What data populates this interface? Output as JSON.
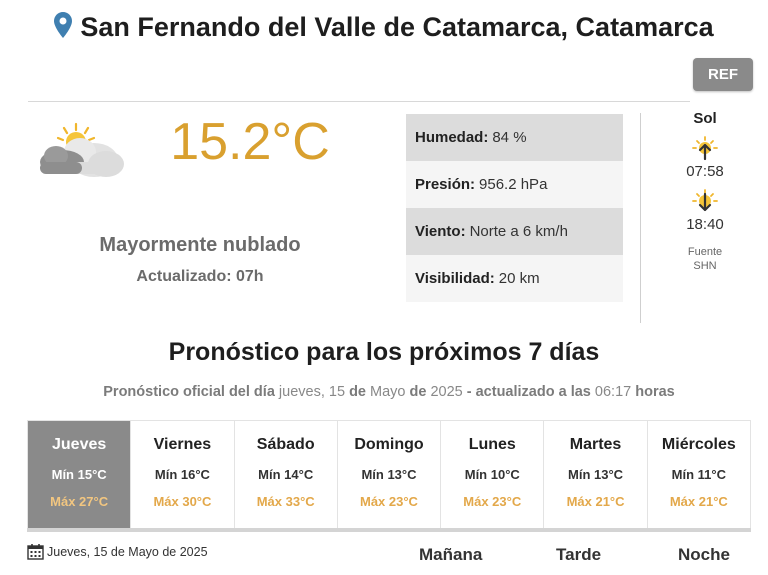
{
  "location": {
    "title": "San Fernando del Valle de Catamarca, Catamarca",
    "icon": "map-pin-icon"
  },
  "ref_button": "REF",
  "current": {
    "icon": "partly-cloudy-icon",
    "temperature": "15.2°C",
    "condition": "Mayormente nublado",
    "updated": "Actualizado: 07h",
    "stats": [
      {
        "label": "Humedad:",
        "value": "84 %"
      },
      {
        "label": "Presión:",
        "value": "956.2 hPa"
      },
      {
        "label": "Viento:",
        "value": "Norte a 6 km/h"
      },
      {
        "label": "Visibilidad:",
        "value": "20 km"
      }
    ]
  },
  "sun": {
    "heading": "Sol",
    "sunrise": "07:58",
    "sunset": "18:40",
    "source_label": "Fuente",
    "source": "SHN"
  },
  "forecast": {
    "title": "Pronóstico para los próximos 7 días",
    "subtitle": {
      "p1": "Pronóstico oficial del día",
      "weekday": "jueves, 15",
      "de1": "de",
      "month": "Mayo",
      "de2": "de",
      "year": "2025",
      "p2": "- actualizado a las",
      "time": "06:17",
      "p3": "horas"
    },
    "days": [
      {
        "name": "Jueves",
        "min": "Mín 15°C",
        "max": "Máx 27°C"
      },
      {
        "name": "Viernes",
        "min": "Mín 16°C",
        "max": "Máx 30°C"
      },
      {
        "name": "Sábado",
        "min": "Mín 14°C",
        "max": "Máx 33°C"
      },
      {
        "name": "Domingo",
        "min": "Mín 13°C",
        "max": "Máx 23°C"
      },
      {
        "name": "Lunes",
        "min": "Mín 10°C",
        "max": "Máx 23°C"
      },
      {
        "name": "Martes",
        "min": "Mín 13°C",
        "max": "Máx 21°C"
      },
      {
        "name": "Miércoles",
        "min": "Mín 11°C",
        "max": "Máx 21°C"
      }
    ],
    "selected_day": "Jueves",
    "date_label": "Jueves, 15 de Mayo de 2025",
    "periods": [
      "Mañana",
      "Tarde",
      "Noche"
    ]
  },
  "colors": {
    "accent_temp": "#d9a02f",
    "max_temp": "#e3a84a",
    "pin": "#3f7fb0",
    "active_day": "#8a8a8a"
  }
}
